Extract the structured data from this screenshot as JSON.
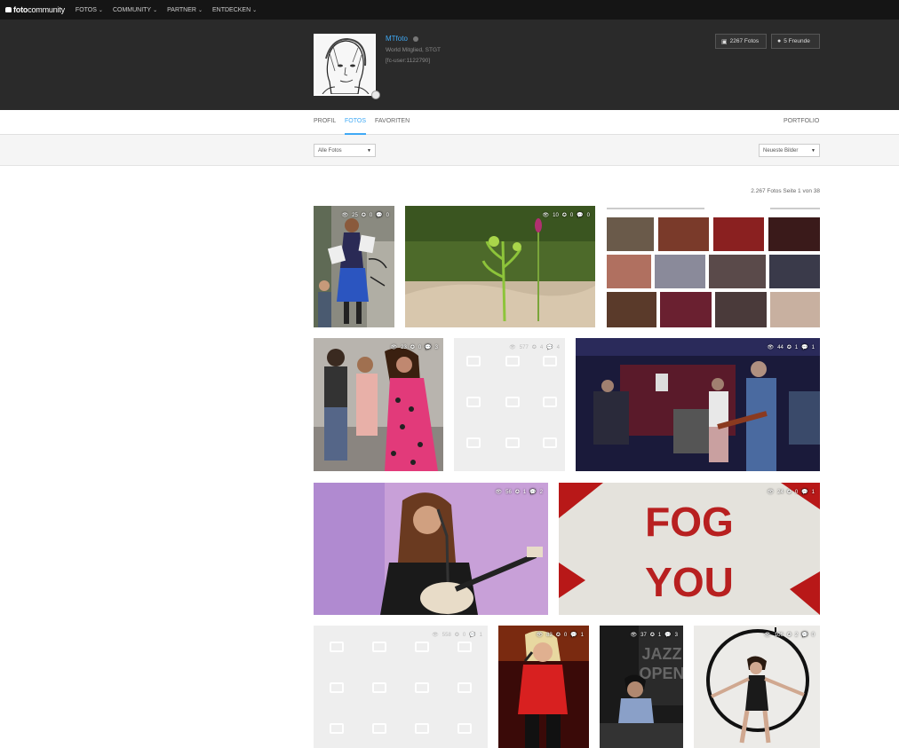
{
  "nav": {
    "logo_bold": "foto",
    "logo_rest": "community",
    "items": [
      {
        "label": "FOTOS"
      },
      {
        "label": "COMMUNITY"
      },
      {
        "label": "PARTNER"
      },
      {
        "label": "ENTDECKEN"
      }
    ]
  },
  "profile": {
    "username": "MTfoto",
    "membership": "World Mitglied, STGT",
    "user_id": "[fc-user:1122790]",
    "photos_button": "2267 Fotos",
    "friends_button": "5 Freunde"
  },
  "tabs": {
    "profil": "PROFIL",
    "fotos": "FOTOS",
    "favoriten": "FAVORITEN",
    "portfolio": "PORTFOLIO"
  },
  "filters": {
    "all_photos": "Alle Fotos",
    "sort": "Neueste Bilder"
  },
  "gallery": {
    "count_text": "2.267 Fotos Seite 1 von 38",
    "tiles": [
      {
        "views": "25",
        "favs": "0",
        "comments": "0"
      },
      {
        "views": "10",
        "favs": "0",
        "comments": "0"
      },
      {
        "views": "",
        "favs": "",
        "comments": ""
      },
      {
        "views": "23",
        "favs": "0",
        "comments": "3"
      },
      {
        "views": "577",
        "favs": "4",
        "comments": "4"
      },
      {
        "views": "44",
        "favs": "1",
        "comments": "1"
      },
      {
        "views": "56",
        "favs": "1",
        "comments": "2"
      },
      {
        "views": "24",
        "favs": "0",
        "comments": "1"
      },
      {
        "views": "558",
        "favs": "0",
        "comments": "1"
      },
      {
        "views": "83",
        "favs": "0",
        "comments": "1"
      },
      {
        "views": "37",
        "favs": "1",
        "comments": "3"
      },
      {
        "views": "106",
        "favs": "2",
        "comments": "0"
      }
    ]
  },
  "art": {
    "graffiti_line1": "FOG",
    "graffiti_line2": "YOU",
    "poster_line1": "JAZZ",
    "poster_line2": "OPEN"
  },
  "icons": {
    "views": "eye-icon",
    "favs": "star-icon",
    "comments": "comment-icon"
  },
  "colors": {
    "accent": "#3fa9f5",
    "topbar": "#151515",
    "header": "#2a2a2a"
  }
}
